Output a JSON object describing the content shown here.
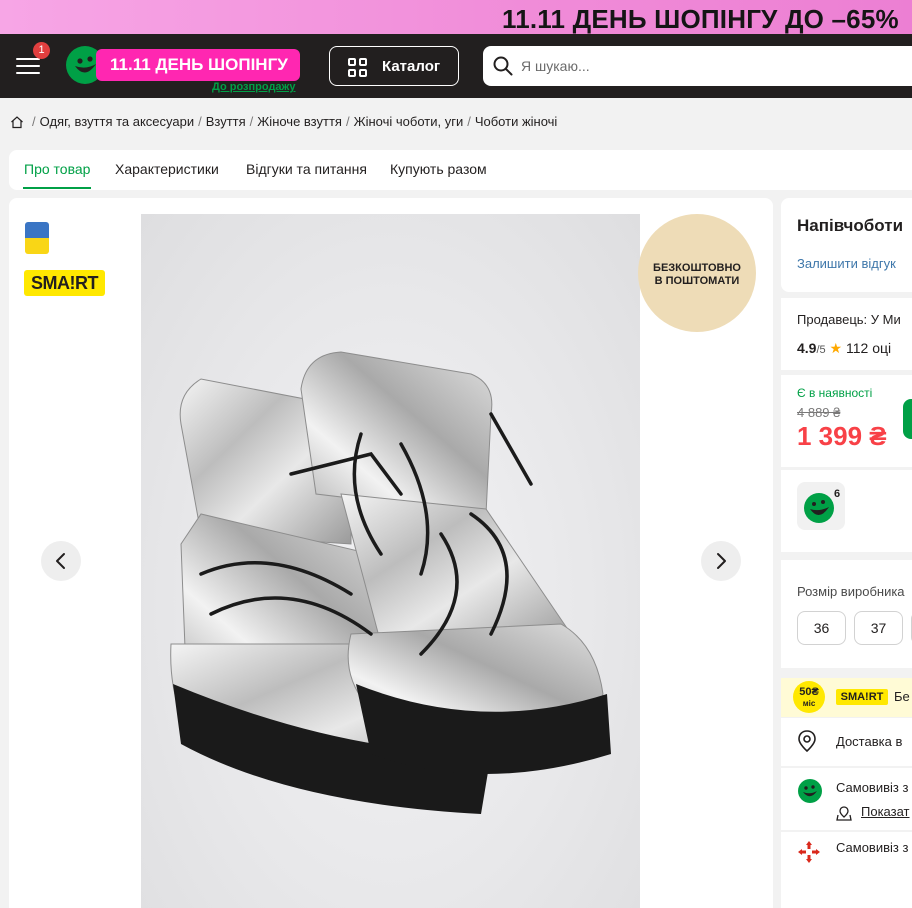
{
  "promo": {
    "text": "11.11 ДЕНЬ ШОПІНГУ ДО –65%"
  },
  "header": {
    "menu_badge": "1",
    "logo_text": "11.11 ДЕНЬ ШОПІНГУ",
    "logo_link": "До розпродажу",
    "catalog_label": "Каталог",
    "search_placeholder": "Я шукаю..."
  },
  "breadcrumbs": [
    "Одяг, взуття та аксесуари",
    "Взуття",
    "Жіноче взуття",
    "Жіночі чоботи, уги",
    "Чоботи жіночі"
  ],
  "tabs": [
    "Про товар",
    "Характеристики",
    "Відгуки та питання",
    "Купують разом"
  ],
  "gallery": {
    "badge_smart": "SMA!RT",
    "free_badge_line1": "БЕЗКОШТОВНО",
    "free_badge_line2": "В ПОШТОМАТИ"
  },
  "product": {
    "title": "Напівчоботи",
    "review_link": "Залишити відгук",
    "seller": "Продавець: У Ми",
    "seller_rating": "4.9",
    "seller_rating_max": "/5",
    "seller_reviews": "112 оці",
    "stock_status": "Є в наявності",
    "old_price": "4 889 ₴",
    "price": "1 399 ₴",
    "loyalty_count": "6"
  },
  "sizes": {
    "label": "Розмір виробника",
    "options": [
      "36",
      "37"
    ]
  },
  "smart": {
    "coin_value": "50₴",
    "coin_unit": "міс",
    "logo": "SMA!RT",
    "text": "Бе"
  },
  "delivery": {
    "city": "Доставка в",
    "pickup_rozetka": "Самовивіз з",
    "show_map": "Показат",
    "pickup_nova": "Самовивіз з"
  },
  "colors": {
    "accent": "#00a046",
    "price": "#f84147",
    "header_bg": "#221f1f",
    "promo_pink": "#ff27b1"
  }
}
